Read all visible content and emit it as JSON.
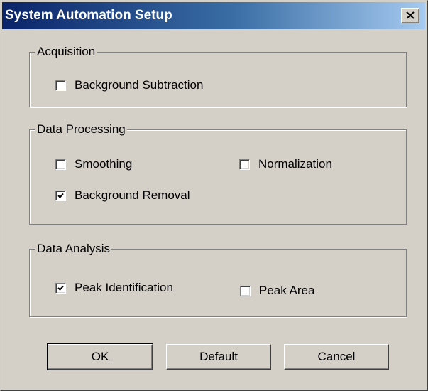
{
  "window": {
    "title": "System Automation Setup",
    "close_icon": "close-icon"
  },
  "acquisition": {
    "legend": "Acquisition",
    "background_subtraction": {
      "label": "Background  Subtraction",
      "checked": false
    }
  },
  "data_processing": {
    "legend": "Data Processing",
    "smoothing": {
      "label": "Smoothing",
      "checked": false
    },
    "normalization": {
      "label": "Normalization",
      "checked": false
    },
    "background_removal": {
      "label": "Background Removal",
      "checked": true
    }
  },
  "data_analysis": {
    "legend": "Data Analysis",
    "peak_identification": {
      "label": "Peak Identification",
      "checked": true
    },
    "peak_area": {
      "label": "Peak Area",
      "checked": false
    }
  },
  "buttons": {
    "ok": "OK",
    "default": "Default",
    "cancel": "Cancel"
  },
  "colors": {
    "face": "#d4d0c8",
    "title_start": "#0a246a",
    "title_end": "#a6caf0"
  }
}
